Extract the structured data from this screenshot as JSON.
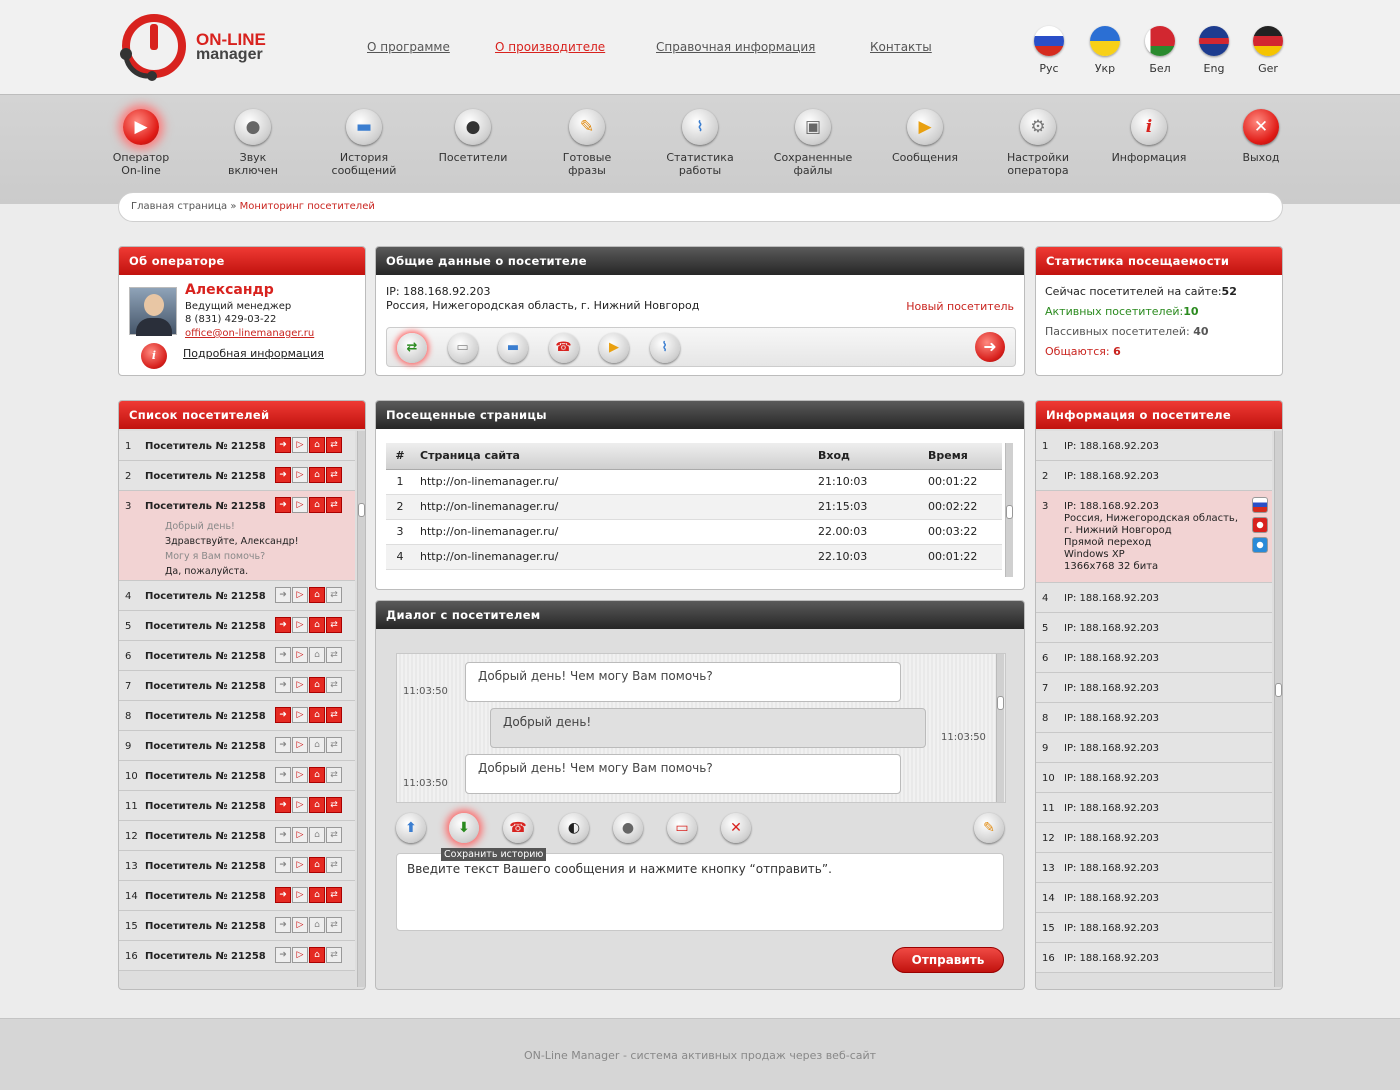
{
  "brand": {
    "line1": "ON-LINE",
    "line2": "manager"
  },
  "topnav": [
    "О программе",
    "О производителе",
    "Справочная информация",
    "Контакты"
  ],
  "languages": [
    "Рус",
    "Укр",
    "Бел",
    "Eng",
    "Ger"
  ],
  "toolbar": [
    {
      "l1": "Оператор",
      "l2": "On-line",
      "icon": "play-icon"
    },
    {
      "l1": "Звук",
      "l2": "включен",
      "icon": "microphone-icon"
    },
    {
      "l1": "История",
      "l2": "сообщений",
      "icon": "folder-icon"
    },
    {
      "l1": "Посетители",
      "l2": "",
      "icon": "user-icon"
    },
    {
      "l1": "Готовые",
      "l2": "фразы",
      "icon": "pencil-icon"
    },
    {
      "l1": "Статистика",
      "l2": "работы",
      "icon": "chart-icon"
    },
    {
      "l1": "Сохраненные",
      "l2": "файлы",
      "icon": "briefcase-icon"
    },
    {
      "l1": "Сообщения",
      "l2": "",
      "icon": "message-icon"
    },
    {
      "l1": "Настройки",
      "l2": "оператора",
      "icon": "gear-icon"
    },
    {
      "l1": "Информация",
      "l2": "",
      "icon": "info-icon"
    },
    {
      "l1": "Выход",
      "l2": "",
      "icon": "close-icon"
    }
  ],
  "breadcrumb": {
    "home": "Главная страница",
    "sep": "»",
    "current": "Мониторинг посетителей"
  },
  "operator": {
    "title": "Об операторе",
    "name": "Александр",
    "role": "Ведущий менеджер",
    "phone": "8 (831) 429-03-22",
    "email": "office@on-linemanager.ru",
    "more": "Подробная информация"
  },
  "visitor_general": {
    "title": "Общие данные о посетителе",
    "ip": "IP: 188.168.92.203",
    "location": "Россия, Нижегородская область, г. Нижний Новгород",
    "status": "Новый посетитель"
  },
  "stats": {
    "title": "Статистика посещаемости",
    "now_label": "Сейчас посетителей на сайте:",
    "now": "52",
    "active_label": "Активных посетителей:",
    "active": "10",
    "passive_label": "Пассивных посетителей:",
    "passive": "40",
    "talking_label": "Общаются:",
    "talking": "6"
  },
  "visitors": {
    "title": "Список посетителей",
    "rows": [
      {
        "n": "1",
        "name": "Посетитель № 21258"
      },
      {
        "n": "2",
        "name": "Посетитель № 21258"
      },
      {
        "n": "3",
        "name": "Посетитель № 21258"
      },
      {
        "n": "4",
        "name": "Посетитель № 21258"
      },
      {
        "n": "5",
        "name": "Посетитель № 21258"
      },
      {
        "n": "6",
        "name": "Посетитель № 21258"
      },
      {
        "n": "7",
        "name": "Посетитель № 21258"
      },
      {
        "n": "8",
        "name": "Посетитель № 21258"
      },
      {
        "n": "9",
        "name": "Посетитель № 21258"
      },
      {
        "n": "10",
        "name": "Посетитель № 21258"
      },
      {
        "n": "11",
        "name": "Посетитель № 21258"
      },
      {
        "n": "12",
        "name": "Посетитель № 21258"
      },
      {
        "n": "13",
        "name": "Посетитель № 21258"
      },
      {
        "n": "14",
        "name": "Посетитель № 21258"
      },
      {
        "n": "15",
        "name": "Посетитель № 21258"
      },
      {
        "n": "16",
        "name": "Посетитель № 21258"
      }
    ],
    "chat_preview": [
      "Добрый день!",
      "Здравствуйте, Александр!",
      "Могу я Вам помочь?",
      "Да, пожалуйста."
    ]
  },
  "pages": {
    "title": "Посещенные страницы",
    "headers": [
      "#",
      "Страница сайта",
      "Вход",
      "Время"
    ],
    "rows": [
      [
        "1",
        "http://on-linemanager.ru/",
        "21:10:03",
        "00:01:22"
      ],
      [
        "2",
        "http://on-linemanager.ru/",
        "21:15:03",
        "00:02:22"
      ],
      [
        "3",
        "http://on-linemanager.ru/",
        "22.00:03",
        "00:03:22"
      ],
      [
        "4",
        "http://on-linemanager.ru/",
        "22.10:03",
        "00:01:22"
      ]
    ]
  },
  "dialog": {
    "title": "Диалог с посетителем",
    "messages": [
      {
        "text": "Добрый день! Чем могу Вам помочь?",
        "time": "11:03:50"
      },
      {
        "text": "Добрый день!",
        "time": "11:03:50"
      },
      {
        "text": "Добрый день! Чем могу Вам помочь?",
        "time": "11:03:50"
      }
    ],
    "tooltip": "Сохранить историю",
    "input_text": "Введите текст Вашего сообщения и нажмите кнопку “отправить”.",
    "send": "Отправить"
  },
  "visitor_info": {
    "title": "Информация о посетителе",
    "rows": [
      {
        "n": "1",
        "ip": "IP: 188.168.92.203"
      },
      {
        "n": "2",
        "ip": "IP: 188.168.92.203"
      },
      {
        "n": "3",
        "ip": "IP: 188.168.92.203"
      },
      {
        "n": "4",
        "ip": "IP: 188.168.92.203"
      },
      {
        "n": "5",
        "ip": "IP: 188.168.92.203"
      },
      {
        "n": "6",
        "ip": "IP: 188.168.92.203"
      },
      {
        "n": "7",
        "ip": "IP: 188.168.92.203"
      },
      {
        "n": "8",
        "ip": "IP: 188.168.92.203"
      },
      {
        "n": "9",
        "ip": "IP: 188.168.92.203"
      },
      {
        "n": "10",
        "ip": "IP: 188.168.92.203"
      },
      {
        "n": "11",
        "ip": "IP: 188.168.92.203"
      },
      {
        "n": "12",
        "ip": "IP: 188.168.92.203"
      },
      {
        "n": "13",
        "ip": "IP: 188.168.92.203"
      },
      {
        "n": "14",
        "ip": "IP: 188.168.92.203"
      },
      {
        "n": "15",
        "ip": "IP: 188.168.92.203"
      },
      {
        "n": "16",
        "ip": "IP: 188.168.92.203"
      }
    ],
    "details": [
      "Россия, Нижегородская область,",
      "г. Нижний Новгород",
      "Прямой переход",
      "Windows XP",
      "1366x768 32 бита"
    ]
  },
  "footer": "ON-Line Manager - система активных продаж через веб-сайт",
  "colors": {
    "accent": "#d8221e",
    "active": "#2a8a1e",
    "dark_header": "#333333"
  }
}
